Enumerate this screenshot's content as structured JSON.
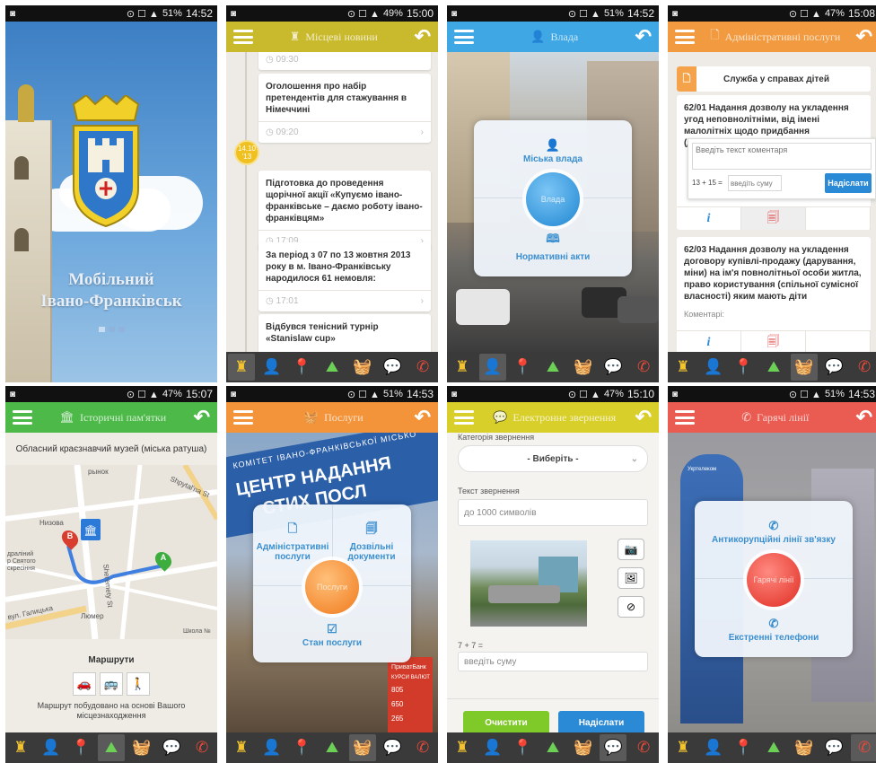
{
  "icons": [
    "monument-icon",
    "user-icon",
    "pin-icon",
    "landscape-icon",
    "basket-icon",
    "chat-icon",
    "phone-icon"
  ],
  "tab_glyphs": [
    "♜",
    "👤",
    "📍",
    "⛰",
    "🧺",
    "💬",
    "✆"
  ],
  "tab_colors": [
    "#f2c230",
    "#3da6e8",
    "#b05ae0",
    "#6ccf56",
    "#f08a30",
    "#f3d832",
    "#e84a3a"
  ],
  "screens": [
    {
      "status": {
        "time": "14:52",
        "battery": "51%"
      },
      "splash": {
        "title_line1": "Мобільний",
        "title_line2": "Івано-Франківськ"
      }
    },
    {
      "status": {
        "time": "15:00",
        "battery": "49%"
      },
      "appbar": {
        "title": "Місцеві новини",
        "color": "#c9b92c"
      },
      "date_badge": {
        "day": "14.10",
        "year": "'13"
      },
      "news": [
        {
          "time": "09:30",
          "text": ""
        },
        {
          "text": "Оголошення про набір претендентів для стажування в Німеччині",
          "time": "09:20"
        },
        {
          "text": "Підготовка до проведення щорічної акції «Купуємо івано-франківське – даємо роботу івано-франківцям»",
          "time": "17:09"
        },
        {
          "text": "За період з 07 по 13 жовтня 2013 року в м. Івано-Франківську народилося 61 немовля:",
          "time": "17:01"
        },
        {
          "text": "Відбувся тенісний турнір «Stanislaw cup»",
          "time": ""
        }
      ]
    },
    {
      "status": {
        "time": "14:52",
        "battery": "51%"
      },
      "appbar": {
        "title": "Влада",
        "color": "#3ea7e4"
      },
      "dial": {
        "top": "Міська влада",
        "center": "Влада",
        "bottom": "Нормативні акти"
      }
    },
    {
      "status": {
        "time": "15:08",
        "battery": "47%"
      },
      "appbar": {
        "title": "Адміністративні послуги",
        "color": "#f29a3f"
      },
      "section": "Служба у справах дітей",
      "card1": "62/01 Надання дозволу на укладення угод неповнолітніми, від імені малолітніх щодо придбання (дарування) на їх ім'я...",
      "comment_placeholder": "Введіть текст коментаря",
      "captcha": "13 + 15 =",
      "sum_placeholder": "введіть суму",
      "send": "Надіслати",
      "card2": "62/03 Надання дозволу на укладення договору купівлі-продажу (дарування, міни) на ім'я повнолітньої особи житла, право користування (спільної сумісної власності) яким мають діти",
      "comments_label": "Коментарі:"
    },
    {
      "status": {
        "time": "15:07",
        "battery": "47%"
      },
      "appbar": {
        "title": "Історичні пам'ятки",
        "color": "#4db949"
      },
      "place": "Обласний краєзнавчий музей (міська ратуша)",
      "map_labels": [
        "Низова",
        "рынок",
        "Shpytal'na St",
        "Sheremety St",
        "вул. Галицька",
        "Люмер",
        "Школа №",
        "Вокзальна",
        "Спец.",
        "драліний",
        "р Святого",
        "скресіння",
        "Гостин.дв.",
        "Nizova",
        "Sheremety St"
      ],
      "routes_title": "Маршрути",
      "route_note": "Маршрут побудовано на основі Вашого місцезнаходження"
    },
    {
      "status": {
        "time": "14:53",
        "battery": "51%"
      },
      "appbar": {
        "title": "Послуги",
        "color": "#f3943a"
      },
      "banner": [
        "КОМІТЕТ ІВАНО-ФРАНКІВСЬКОЇ МІСЬКО",
        "ЦЕНТР НАДАННЯ",
        "СТИХ ПОСЛ"
      ],
      "dial": {
        "left": "Адміністративні послуги",
        "right": "Дозвільні документи",
        "center": "Послуги",
        "bottom": "Стан послуги"
      },
      "bank": [
        "ПриватБанк",
        "ПриватБанк",
        "КУРСИ ВАЛЮТ",
        "805",
        "650",
        "265"
      ]
    },
    {
      "status": {
        "time": "15:10",
        "battery": "47%"
      },
      "appbar": {
        "title": "Електронне звернення",
        "color": "#d8cf2a"
      },
      "category_label": "Категорія звернення",
      "select_value": "- Виберіть -",
      "text_label": "Текст звернення",
      "text_placeholder": "до 1000 символів",
      "captcha": "7 + 7 =",
      "sum_placeholder": "введіть суму",
      "clear": "Очистити",
      "send": "Надіслати"
    },
    {
      "status": {
        "time": "14:53",
        "battery": "51%"
      },
      "appbar": {
        "title": "Гарячі лінії",
        "color": "#ea5c52"
      },
      "dial": {
        "top": "Антикорупційні лінії зв'язку",
        "center": "Гарячі лінії",
        "bottom": "Екстренні телефони"
      },
      "booth_label": "Укртелеком"
    }
  ]
}
